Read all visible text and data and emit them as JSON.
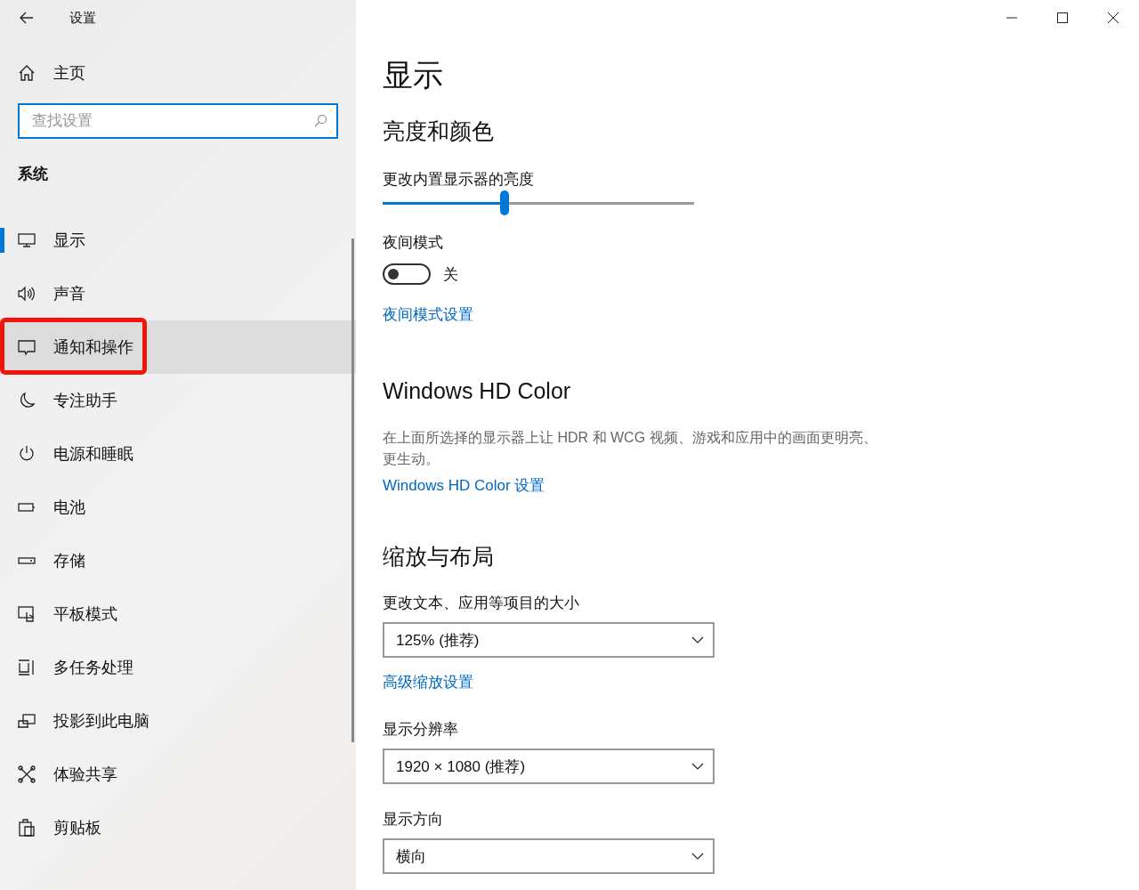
{
  "window": {
    "title": "设置"
  },
  "sidebar": {
    "home": "主页",
    "search": {
      "placeholder": "查找设置"
    },
    "section": "系统",
    "items": [
      {
        "label": "显示",
        "selected": true,
        "hovered": false,
        "annotated": false
      },
      {
        "label": "声音",
        "selected": false,
        "hovered": false,
        "annotated": false
      },
      {
        "label": "通知和操作",
        "selected": false,
        "hovered": true,
        "annotated": true
      },
      {
        "label": "专注助手",
        "selected": false,
        "hovered": false,
        "annotated": false
      },
      {
        "label": "电源和睡眠",
        "selected": false,
        "hovered": false,
        "annotated": false
      },
      {
        "label": "电池",
        "selected": false,
        "hovered": false,
        "annotated": false
      },
      {
        "label": "存储",
        "selected": false,
        "hovered": false,
        "annotated": false
      },
      {
        "label": "平板模式",
        "selected": false,
        "hovered": false,
        "annotated": false
      },
      {
        "label": "多任务处理",
        "selected": false,
        "hovered": false,
        "annotated": false
      },
      {
        "label": "投影到此电脑",
        "selected": false,
        "hovered": false,
        "annotated": false
      },
      {
        "label": "体验共享",
        "selected": false,
        "hovered": false,
        "annotated": false
      },
      {
        "label": "剪贴板",
        "selected": false,
        "hovered": false,
        "annotated": false
      }
    ]
  },
  "page": {
    "title": "显示",
    "brightness": {
      "heading": "亮度和颜色",
      "label": "更改内置显示器的亮度",
      "level": 0.39
    },
    "night_light": {
      "label": "夜间模式",
      "on": false,
      "state": "关",
      "link": "夜间模式设置"
    },
    "hdr": {
      "heading": "Windows HD Color",
      "description": "在上面所选择的显示器上让 HDR 和 WCG 视频、游戏和应用中的画面更明亮、更生动。",
      "link": "Windows HD Color 设置"
    },
    "scale": {
      "heading": "缩放与布局",
      "fields": [
        {
          "label": "更改文本、应用等项目的大小",
          "value": "125% (推荐)",
          "link": "高级缩放设置"
        },
        {
          "label": "显示分辨率",
          "value": "1920 × 1080 (推荐)"
        },
        {
          "label": "显示方向",
          "value": "横向"
        }
      ]
    }
  }
}
